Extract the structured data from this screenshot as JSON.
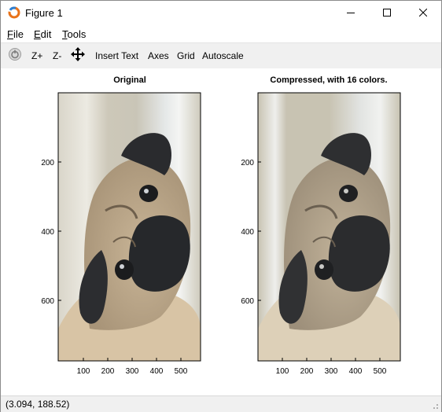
{
  "window": {
    "title": "Figure 1",
    "controls": [
      "minimize",
      "maximize",
      "close"
    ]
  },
  "menu": {
    "file": {
      "mnemonic": "F",
      "rest": "ile"
    },
    "edit": {
      "mnemonic": "E",
      "rest": "dit"
    },
    "tools": {
      "mnemonic": "T",
      "rest": "ools"
    }
  },
  "toolbar": {
    "zoom_in": "Z+",
    "zoom_out": "Z-",
    "insert_text": "Insert Text",
    "axes": "Axes",
    "grid": "Grid",
    "autoscale": "Autoscale"
  },
  "figure": {
    "left_plot": {
      "title": "Original",
      "yticks": [
        "200",
        "400",
        "600"
      ],
      "xticks": [
        "100",
        "200",
        "300",
        "400",
        "500"
      ]
    },
    "right_plot": {
      "title": "Compressed, with 16 colors.",
      "yticks": [
        "200",
        "400",
        "600"
      ],
      "xticks": [
        "100",
        "200",
        "300",
        "400",
        "500"
      ]
    }
  },
  "status": {
    "coordinates": "(3.094, 188.52)"
  },
  "colors": {
    "toolbar_bg": "#f0f0f0",
    "status_bg": "#f0f0f0"
  }
}
